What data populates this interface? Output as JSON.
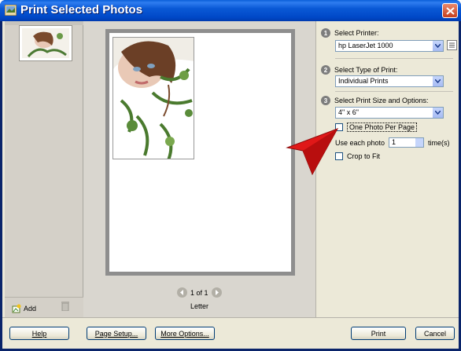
{
  "window": {
    "title": "Print Selected Photos"
  },
  "left": {
    "add_label": "Add"
  },
  "preview": {
    "page_indicator": "1 of 1",
    "paper": "Letter"
  },
  "steps": {
    "printer": {
      "num": "1",
      "label": "Select Printer:",
      "value": "hp LaserJet 1000"
    },
    "type": {
      "num": "2",
      "label": "Select Type of Print:",
      "value": "Individual Prints"
    },
    "size": {
      "num": "3",
      "label": "Select Print Size and Options:",
      "value": "4\" x 6\""
    }
  },
  "options": {
    "one_per_page": "One Photo Per Page",
    "use_each_label": "Use each photo",
    "use_each_value": "1",
    "times": "time(s)",
    "crop": "Crop to Fit"
  },
  "buttons": {
    "help": "Help",
    "page_setup": "Page Setup...",
    "more_options": "More Options...",
    "print": "Print",
    "cancel": "Cancel"
  }
}
